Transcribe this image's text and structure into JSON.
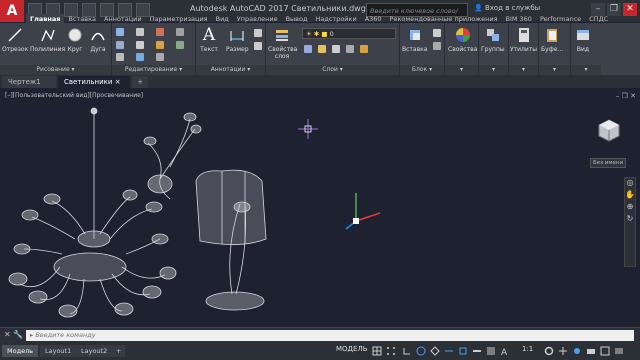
{
  "app": {
    "title": "Autodesk AutoCAD 2017   Светильники.dwg",
    "search_placeholder": "Введите ключевое слово/фразу",
    "signin": "Вход в службы",
    "logo": "A"
  },
  "ribbon_tabs": [
    "Главная",
    "Вставка",
    "Аннотации",
    "Параметризация",
    "Вид",
    "Управление",
    "Вывод",
    "Надстройки",
    "A360",
    "Рекомендованные приложения",
    "BIM 360",
    "Performance",
    "СПДС"
  ],
  "panels": {
    "draw": {
      "title": "Рисование",
      "tools": [
        "Отрезок",
        "Полилиния",
        "Круг",
        "Дуга"
      ]
    },
    "modify": {
      "title": "Редактирование"
    },
    "annotation": {
      "title": "Аннотации",
      "tools": [
        "Текст",
        "Размер"
      ]
    },
    "layers": {
      "title": "Слои",
      "properties_label": "Свойства слоя",
      "layer_value": "0"
    },
    "block": {
      "title": "Блок",
      "insert_label": "Вставка"
    },
    "properties": {
      "label": "Свойства"
    },
    "groups": {
      "label": "Группы"
    },
    "utilities": {
      "label": "Утилиты"
    },
    "clipboard": {
      "label": "Буфе..."
    },
    "view": {
      "label": "Вид"
    }
  },
  "doc_tabs": [
    "Чертеж1",
    "Светильники"
  ],
  "viewport": {
    "label": "[–][Пользовательский вид][Просвечивание]",
    "wcs_label": "Без имени"
  },
  "command": {
    "placeholder": "Введите команду"
  },
  "layout_tabs": [
    "Модель",
    "Layout1",
    "Layout2"
  ],
  "status": {
    "model": "МОДЕЛЬ",
    "scale": "1:1"
  }
}
